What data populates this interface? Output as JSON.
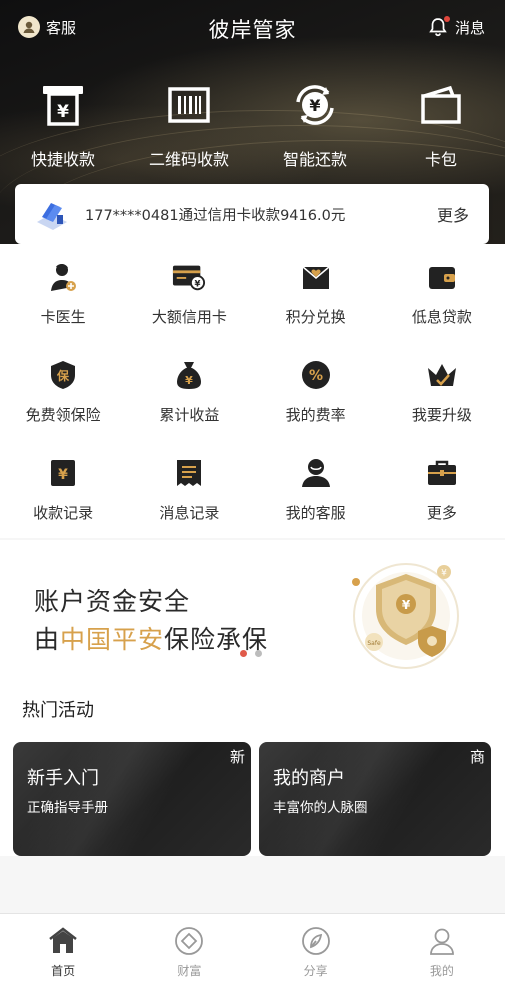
{
  "topbar": {
    "cs_label": "客服",
    "title": "彼岸管家",
    "msg_label": "消息"
  },
  "quick_actions": [
    {
      "label": "快捷收款",
      "icon": "yuan-receipt-icon"
    },
    {
      "label": "二维码收款",
      "icon": "barcode-icon"
    },
    {
      "label": "智能还款",
      "icon": "yuan-refresh-icon"
    },
    {
      "label": "卡包",
      "icon": "wallet-icon"
    }
  ],
  "notice": {
    "text": "177****0481通过信用卡收款9416.0元",
    "more": "更多"
  },
  "services": [
    {
      "label": "卡医生",
      "icon": "doctor-icon"
    },
    {
      "label": "大额信用卡",
      "icon": "credit-card-icon"
    },
    {
      "label": "积分兑换",
      "icon": "gift-envelope-icon"
    },
    {
      "label": "低息贷款",
      "icon": "wallet-icon"
    },
    {
      "label": "免费领保险",
      "icon": "insurance-shield-icon"
    },
    {
      "label": "累计收益",
      "icon": "money-bag-icon"
    },
    {
      "label": "我的费率",
      "icon": "percent-icon"
    },
    {
      "label": "我要升级",
      "icon": "crown-icon"
    },
    {
      "label": "收款记录",
      "icon": "yuan-record-icon"
    },
    {
      "label": "消息记录",
      "icon": "message-list-icon"
    },
    {
      "label": "我的客服",
      "icon": "person-icon"
    },
    {
      "label": "更多",
      "icon": "briefcase-icon"
    }
  ],
  "banner": {
    "line1": "账户资金安全",
    "line2_prefix": "由",
    "line2_highlight": "中国平安",
    "line2_suffix": "保险承保",
    "shield_small_text": "Safe",
    "slides": 2,
    "active_slide": 1
  },
  "hot": {
    "title": "热门活动",
    "items": [
      {
        "title": "新手入门",
        "subtitle": "正确指导手册",
        "badge": "新"
      },
      {
        "title": "我的商户",
        "subtitle": "丰富你的人脉圈",
        "badge": "商"
      }
    ]
  },
  "nav": [
    {
      "label": "首页",
      "icon": "home-icon",
      "active": true
    },
    {
      "label": "财富",
      "icon": "diamond-icon",
      "active": false
    },
    {
      "label": "分享",
      "icon": "leaf-icon",
      "active": false
    },
    {
      "label": "我的",
      "icon": "user-icon",
      "active": false
    }
  ],
  "colors": {
    "accent_gold": "#d7a14c",
    "header_dark": "#1a1918",
    "badge_red": "#e0463c"
  }
}
